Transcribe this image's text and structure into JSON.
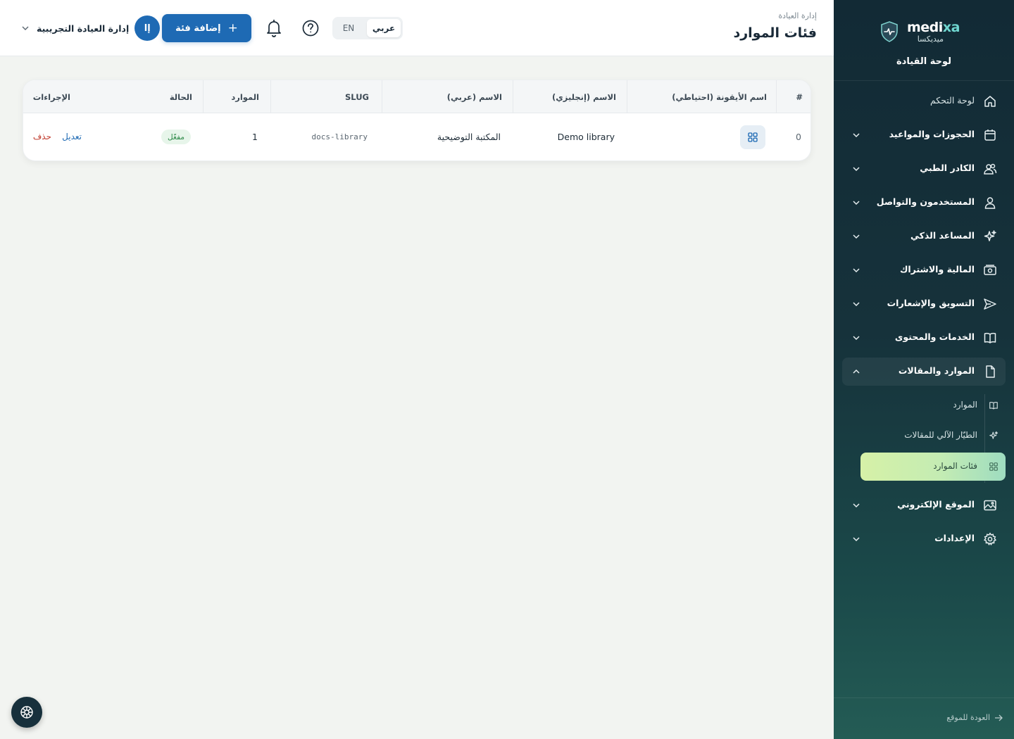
{
  "brand": {
    "name_part1": "medi",
    "name_part2": "xa",
    "subtitle": "ميديكسا"
  },
  "sidebar": {
    "heading": "لوحة القيادة",
    "items": [
      {
        "label": "لوحة التحكم",
        "icon": "home-icon"
      },
      {
        "label": "الحجوزات والمواعيد",
        "icon": "calendar-icon"
      },
      {
        "label": "الكادر الطبي",
        "icon": "users-icon"
      },
      {
        "label": "المستخدمون والتواصل",
        "icon": "user-icon"
      },
      {
        "label": "المساعد الذكي",
        "icon": "sparkles-icon"
      },
      {
        "label": "المالية والاشتراك",
        "icon": "money-icon"
      },
      {
        "label": "التسويق والإشعارات",
        "icon": "send-icon"
      },
      {
        "label": "الخدمات والمحتوى",
        "icon": "book-icon"
      },
      {
        "label": "الموارد والمقالات",
        "icon": "file-icon"
      },
      {
        "label": "الموقع الإلكتروني",
        "icon": "image-icon"
      },
      {
        "label": "الإعدادات",
        "icon": "gear-icon"
      }
    ],
    "subitems": [
      {
        "label": "الموارد",
        "icon": "book-icon"
      },
      {
        "label": "الطيّار الآلي للمقالات",
        "icon": "sparkles-icon"
      },
      {
        "label": "فئات الموارد",
        "icon": "grid-icon"
      }
    ],
    "back_link": "العودة للموقع"
  },
  "header": {
    "breadcrumb": "إدارة العيادة",
    "title": "فئات الموارد",
    "lang_ar": "عربي",
    "lang_en": "EN",
    "add_button": "إضافة فئة",
    "add_icon": "+",
    "avatar_initials": "إا",
    "account_name": "إدارة العيادة التجريبية"
  },
  "table": {
    "columns": [
      "#",
      "اسم الأيقونة (احتياطي)",
      "الاسم (إنجليزي)",
      "الاسم (عربي)",
      "SLUG",
      "الموارد",
      "الحالة",
      "الإجراءات"
    ],
    "rows": [
      {
        "index": "0",
        "icon": "grid-icon",
        "name_en": "Demo library",
        "name_ar": "المكتبة التوضيحية",
        "slug": "docs-library",
        "resources": "1",
        "status": "مفعّل",
        "edit": "تعديل",
        "delete": "حذف"
      }
    ]
  },
  "colors": {
    "accent": "#1e6ab4",
    "sidebar_bg": "#122a35",
    "active_item": "#c4ecb3",
    "status_active": "#2e8a48",
    "delete": "#c0392b"
  }
}
